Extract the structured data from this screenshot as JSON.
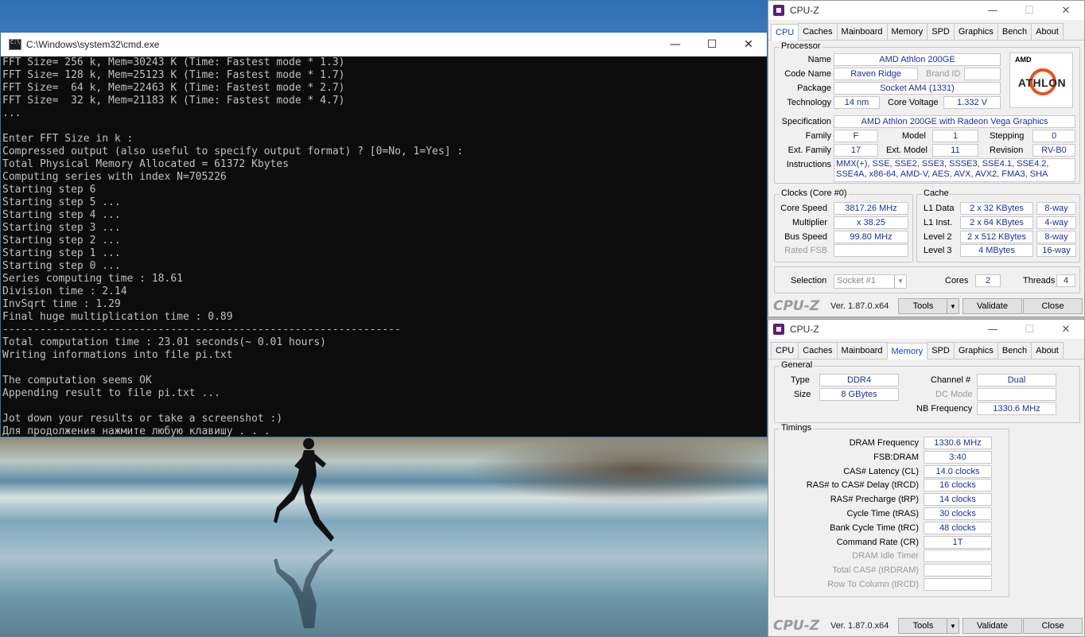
{
  "cmd": {
    "title": "C:\\Windows\\system32\\cmd.exe",
    "lines": [
      "FFT Size= 256 k, Mem=30243 K (Time: Fastest mode * 1.3)",
      "FFT Size= 128 k, Mem=25123 K (Time: Fastest mode * 1.7)",
      "FFT Size=  64 k, Mem=22463 K (Time: Fastest mode * 2.7)",
      "FFT Size=  32 k, Mem=21183 K (Time: Fastest mode * 4.7)",
      "...",
      "",
      "Enter FFT Size in k :",
      "Compressed output (also useful to specify output format) ? [0=No, 1=Yes] :",
      "Total Physical Memory Allocated = 61372 Kbytes",
      "Computing series with index N=705226",
      "Starting step 6",
      "Starting step 5 ...",
      "Starting step 4 ...",
      "Starting step 3 ...",
      "Starting step 2 ...",
      "Starting step 1 ...",
      "Starting step 0 ...",
      "Series computing time : 18.61",
      "Division time : 2.14",
      "InvSqrt time : 1.29",
      "Final huge multiplication time : 0.89",
      "----------------------------------------------------------------",
      "Total computation time : 23.01 seconds(~ 0.01 hours)",
      "Writing informations into file pi.txt",
      "",
      "The computation seems OK",
      "Appending result to file pi.txt ...",
      "",
      "Jot down your results or take a screenshot :)",
      "Для продолжения нажмите любую клавишу . . ."
    ]
  },
  "cpuz_common": {
    "app_title": "CPU-Z",
    "tabs": [
      "CPU",
      "Caches",
      "Mainboard",
      "Memory",
      "SPD",
      "Graphics",
      "Bench",
      "About"
    ],
    "brand": "CPU-Z",
    "version": "Ver. 1.87.0.x64",
    "tools": "Tools",
    "validate": "Validate",
    "close": "Close"
  },
  "cpu": {
    "processor_title": "Processor",
    "name_label": "Name",
    "name": "AMD Athlon 200GE",
    "codename_label": "Code Name",
    "codename": "Raven Ridge",
    "brandid_label": "Brand ID",
    "brandid": "",
    "package_label": "Package",
    "package": "Socket AM4 (1331)",
    "technology_label": "Technology",
    "technology": "14 nm",
    "voltage_label": "Core Voltage",
    "voltage": "1.332 V",
    "spec_label": "Specification",
    "spec": "AMD Athlon 200GE with Radeon Vega Graphics",
    "family_label": "Family",
    "family": "F",
    "model_label": "Model",
    "model": "1",
    "stepping_label": "Stepping",
    "stepping": "0",
    "extfamily_label": "Ext. Family",
    "extfamily": "17",
    "extmodel_label": "Ext. Model",
    "extmodel": "11",
    "revision_label": "Revision",
    "revision": "RV-B0",
    "instr_label": "Instructions",
    "instructions": "MMX(+), SSE, SSE2, SSE3, SSSE3, SSE4.1, SSE4.2, SSE4A, x86-64, AMD-V, AES, AVX, AVX2, FMA3, SHA",
    "logo_top": "AMD",
    "logo_main": "ATHLON",
    "clocks_title": "Clocks (Core #0)",
    "corespeed_label": "Core Speed",
    "corespeed": "3817.26 MHz",
    "multiplier_label": "Multiplier",
    "multiplier": "x 38.25",
    "busspeed_label": "Bus Speed",
    "busspeed": "99.80 MHz",
    "ratedfsb_label": "Rated FSB",
    "ratedfsb": "",
    "cache_title": "Cache",
    "l1d_label": "L1 Data",
    "l1d": "2 x 32 KBytes",
    "l1d_way": "8-way",
    "l1i_label": "L1 Inst.",
    "l1i": "2 x 64 KBytes",
    "l1i_way": "4-way",
    "l2_label": "Level 2",
    "l2": "2 x 512 KBytes",
    "l2_way": "8-way",
    "l3_label": "Level 3",
    "l3": "4 MBytes",
    "l3_way": "16-way",
    "selection_label": "Selection",
    "selection": "Socket #1",
    "cores_label": "Cores",
    "cores": "2",
    "threads_label": "Threads",
    "threads": "4"
  },
  "memory": {
    "general_title": "General",
    "type_label": "Type",
    "type": "DDR4",
    "size_label": "Size",
    "size": "8 GBytes",
    "channel_label": "Channel #",
    "channel": "Dual",
    "dcmode_label": "DC Mode",
    "dcmode": "",
    "nbfreq_label": "NB Frequency",
    "nbfreq": "1330.6 MHz",
    "timings_title": "Timings",
    "timings": [
      {
        "label": "DRAM Frequency",
        "value": "1330.6 MHz",
        "dim": false
      },
      {
        "label": "FSB:DRAM",
        "value": "3:40",
        "dim": false
      },
      {
        "label": "CAS# Latency (CL)",
        "value": "14.0 clocks",
        "dim": false
      },
      {
        "label": "RAS# to CAS# Delay (tRCD)",
        "value": "16 clocks",
        "dim": false
      },
      {
        "label": "RAS# Precharge (tRP)",
        "value": "14 clocks",
        "dim": false
      },
      {
        "label": "Cycle Time (tRAS)",
        "value": "30 clocks",
        "dim": false
      },
      {
        "label": "Bank Cycle Time (tRC)",
        "value": "48 clocks",
        "dim": false
      },
      {
        "label": "Command Rate (CR)",
        "value": "1T",
        "dim": false
      },
      {
        "label": "DRAM Idle Timer",
        "value": "",
        "dim": true
      },
      {
        "label": "Total CAS# (tRDRAM)",
        "value": "",
        "dim": true
      },
      {
        "label": "Row To Column (tRCD)",
        "value": "",
        "dim": true
      }
    ]
  }
}
